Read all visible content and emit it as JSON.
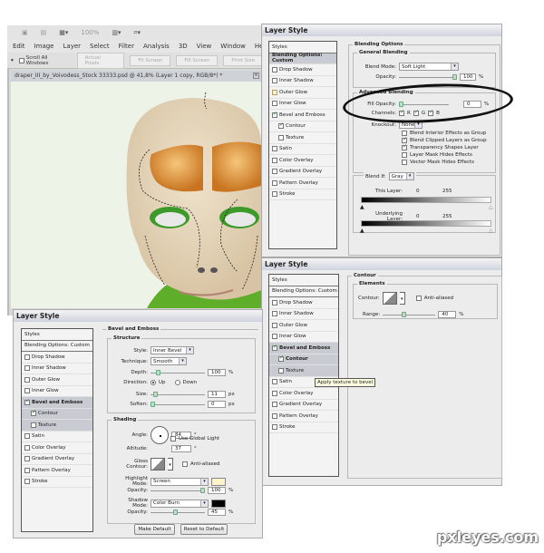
{
  "photoshop": {
    "toolbar_zoom": "100%",
    "menu": [
      "Edit",
      "Image",
      "Layer",
      "Select",
      "Filter",
      "Analysis",
      "3D",
      "View",
      "Window",
      "Help"
    ],
    "options": {
      "scroll_all_windows": "Scroll All Windows",
      "buttons": [
        "Actual Pixels",
        "Fit Screen",
        "Fill Screen",
        "Print Size"
      ]
    },
    "document_tab": "draper_III_by_Voivodess_Stock  33333.psd @ 41,8% (Layer 1 copy, RGB/8*) *",
    "close_glyph": "×"
  },
  "styles_list": {
    "styles": "Styles",
    "blending": "Blending Options: Custom",
    "items": [
      "Drop Shadow",
      "Inner Shadow",
      "Outer Glow",
      "Inner Glow",
      "Bevel and Emboss",
      "Contour",
      "Texture",
      "Satin",
      "Color Overlay",
      "Gradient Overlay",
      "Pattern Overlay",
      "Stroke"
    ]
  },
  "dialog_blending": {
    "title": "Layer Style",
    "section": "Blending Options",
    "general": "General Blending",
    "blend_mode_label": "Blend Mode:",
    "blend_mode": "Soft Light",
    "opacity_label": "Opacity:",
    "opacity": "100",
    "opacity_pct": 100,
    "pct": "%",
    "advanced": "Advanced Blending",
    "fill_opacity_label": "Fill Opacity:",
    "fill_opacity": "0",
    "fill_opacity_pct": 0,
    "channels_label": "Channels:",
    "channels": [
      "R",
      "G",
      "B"
    ],
    "knockout_label": "Knockout:",
    "knockout": "None",
    "options": [
      {
        "label": "Blend Interior Effects as Group",
        "checked": false
      },
      {
        "label": "Blend Clipped Layers as Group",
        "checked": true
      },
      {
        "label": "Transparency Shapes Layer",
        "checked": true
      },
      {
        "label": "Layer Mask Hides Effects",
        "checked": false
      },
      {
        "label": "Vector Mask Hides Effects",
        "checked": false
      }
    ],
    "blend_if_label": "Blend If:",
    "blend_if": "Gray",
    "this_layer_label": "This Layer:",
    "underlying_label": "Underlying Layer:",
    "low": "0",
    "high": "255"
  },
  "dialog_contour": {
    "title": "Layer Style",
    "section": "Contour",
    "elements": "Elements",
    "contour_label": "Contour:",
    "anti_aliased": "Anti-aliased",
    "range_label": "Range:",
    "range": "40",
    "range_pct": 40,
    "pct": "%",
    "tooltip": "Apply texture to bevel"
  },
  "dialog_bevel": {
    "title": "Layer Style",
    "section": "Bevel and Emboss",
    "structure": "Structure",
    "style_label": "Style:",
    "style": "Inner Bevel",
    "technique_label": "Technique:",
    "technique": "Smooth",
    "depth_label": "Depth:",
    "depth": "100",
    "depth_pct": 100,
    "direction_label": "Direction:",
    "dir_up": "Up",
    "dir_down": "Down",
    "size_label": "Size:",
    "size": "11",
    "soften_label": "Soften:",
    "soften": "0",
    "px": "px",
    "pct": "%",
    "shading": "Shading",
    "angle_label": "Angle:",
    "angle": "84",
    "deg": "°",
    "global_light": "Use Global Light",
    "altitude_label": "Altitude:",
    "altitude": "37",
    "gloss_label": "Gloss Contour:",
    "anti_aliased": "Anti-aliased",
    "highlight_label": "Highlight Mode:",
    "highlight_mode": "Screen",
    "highlight_color": "#fff3cc",
    "h_opacity_label": "Opacity:",
    "h_opacity": "100",
    "shadow_label": "Shadow Mode:",
    "shadow_mode": "Color Burn",
    "shadow_color": "#000000",
    "s_opacity_label": "Opacity:",
    "s_opacity": "45",
    "make_default": "Make Default",
    "reset_default": "Reset to Default"
  },
  "watermark": "pxleyes.com"
}
